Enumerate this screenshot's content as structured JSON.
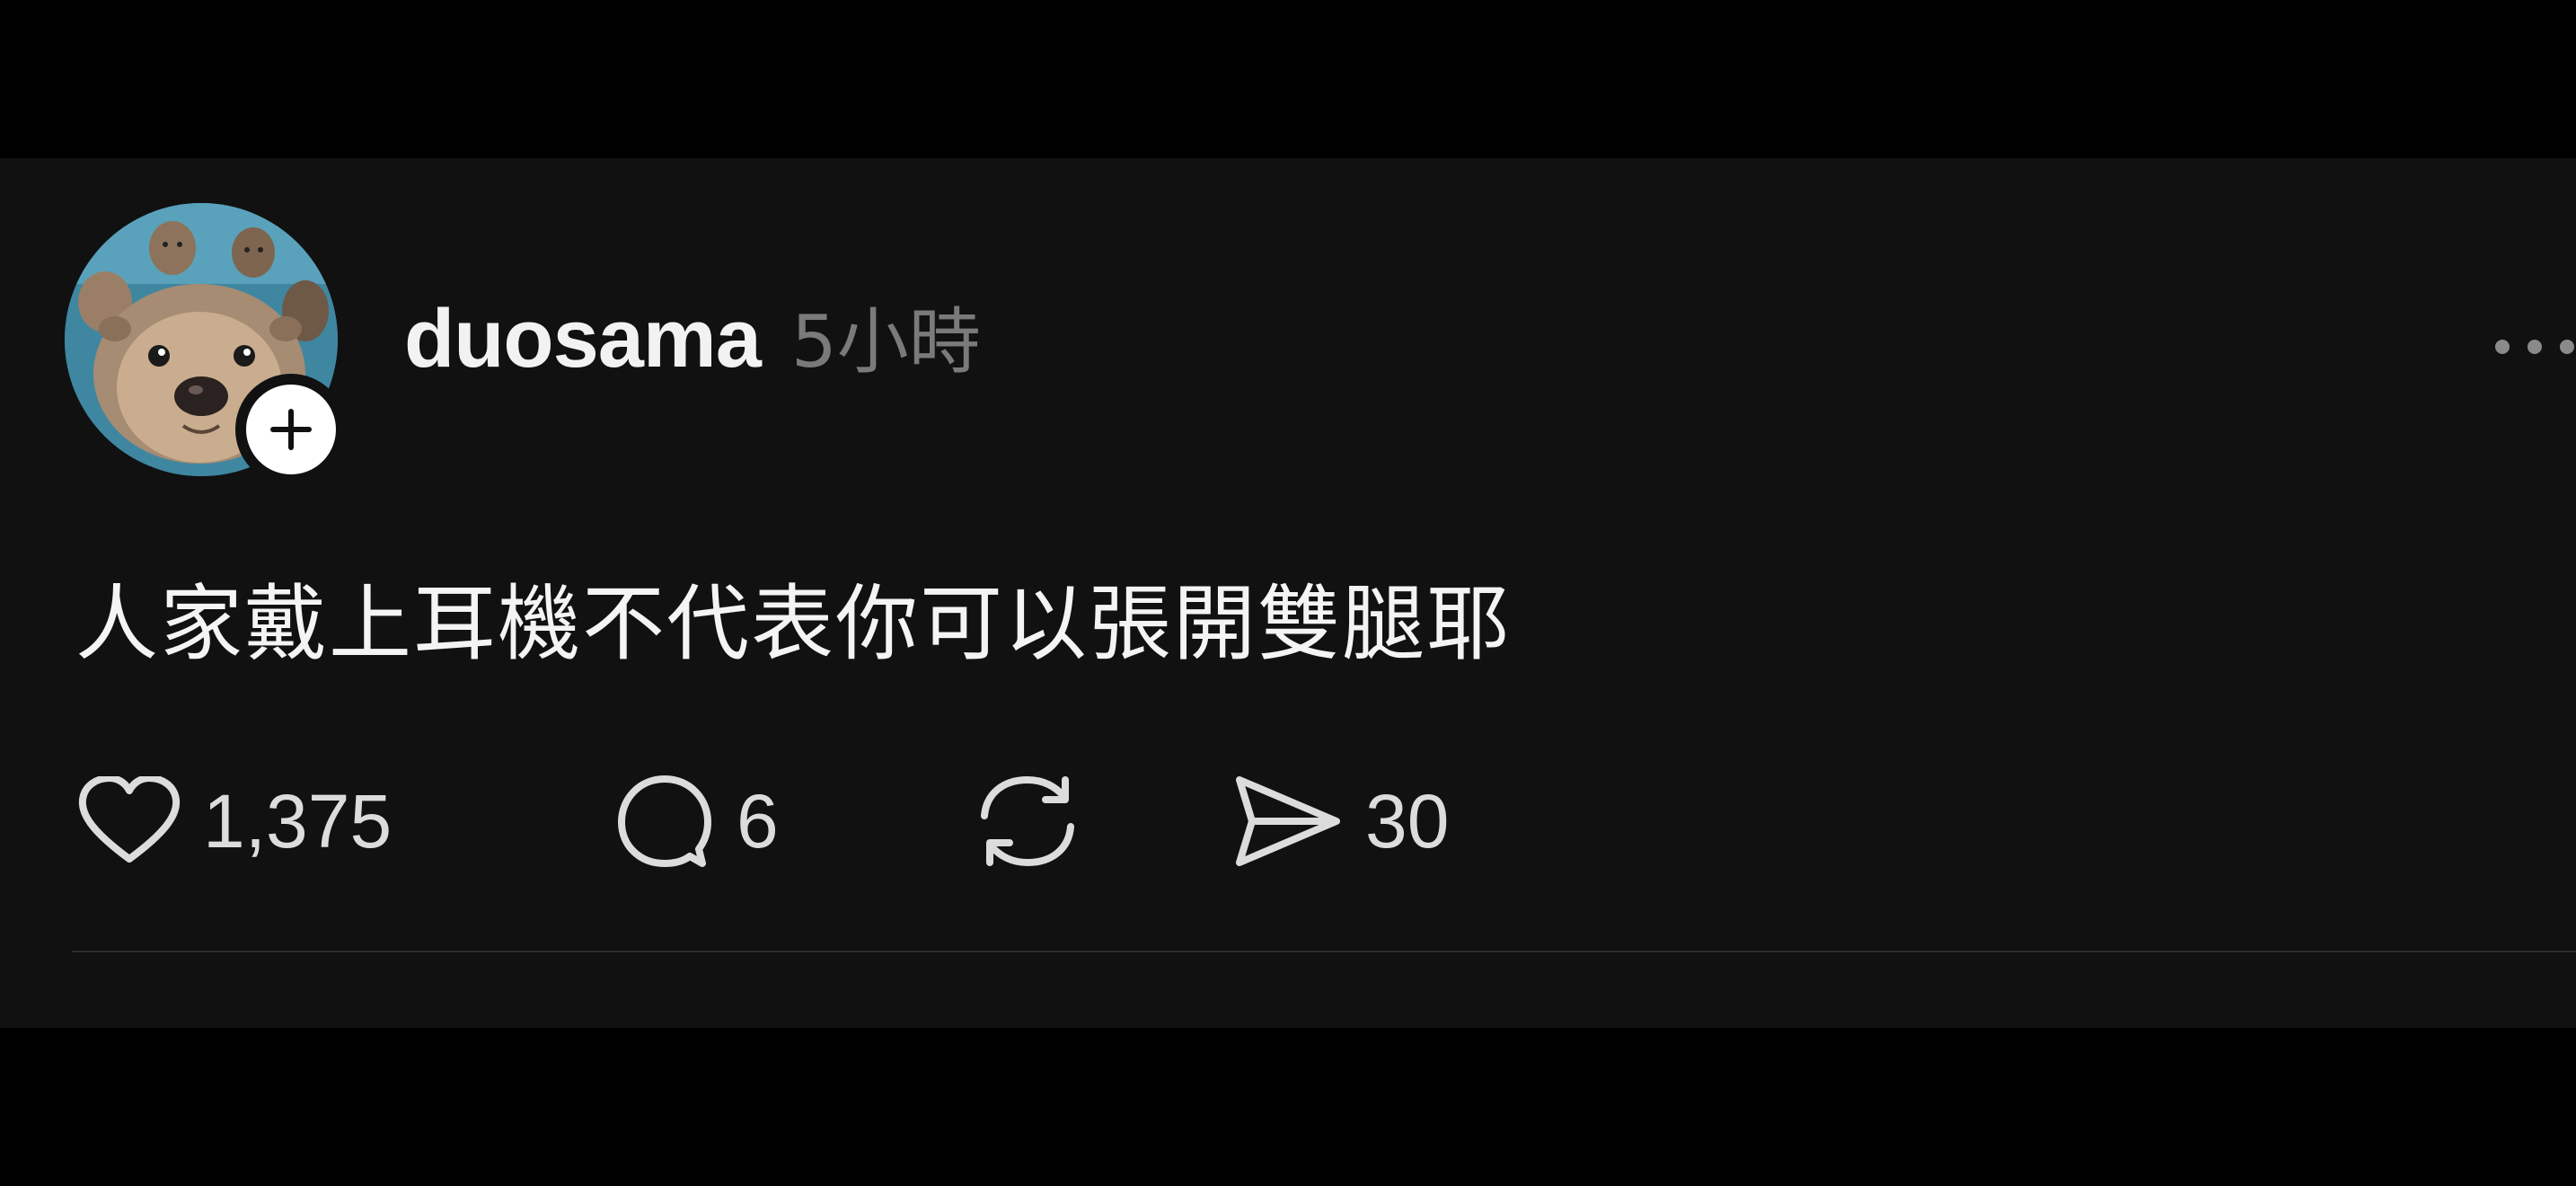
{
  "post": {
    "username": "duosama",
    "timestamp": "5小時",
    "text": "人家戴上耳機不代表你可以張開雙腿耶",
    "actions": {
      "likes": "1,375",
      "replies": "6",
      "shares": "30"
    }
  },
  "icons": {
    "avatar": "otter-avatar",
    "follow": "plus-icon",
    "more": "more-horizontal-icon",
    "like": "heart-icon",
    "reply": "comment-icon",
    "repost": "repost-icon",
    "share": "send-icon"
  },
  "colors": {
    "background": "#000000",
    "card": "#111111",
    "text": "#f4f4f4",
    "muted": "#7a7a7a"
  }
}
